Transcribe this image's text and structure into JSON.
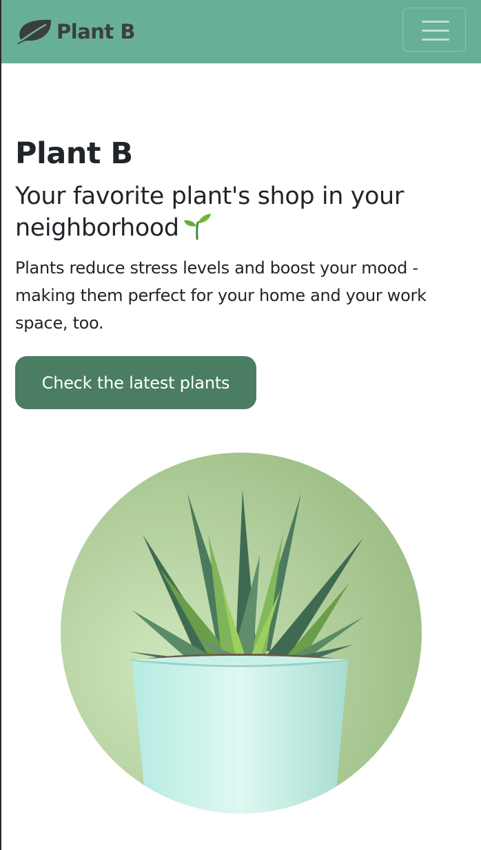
{
  "navbar": {
    "brand_name": "Plant B",
    "brand_icon": "leaf-icon",
    "menu_icon": "hamburger-menu-icon",
    "background_color": "#67b096"
  },
  "hero": {
    "title": "Plant B",
    "subtitle": "Your favorite plant's shop in your neighborhood",
    "subtitle_icon": "seedling-icon",
    "description": "Plants reduce stress levels and boost your mood - making them perfect for your home and your work space, too.",
    "cta_label": "Check the latest plants",
    "cta_color": "#4a7d62",
    "image": "potted-succulent-image"
  }
}
